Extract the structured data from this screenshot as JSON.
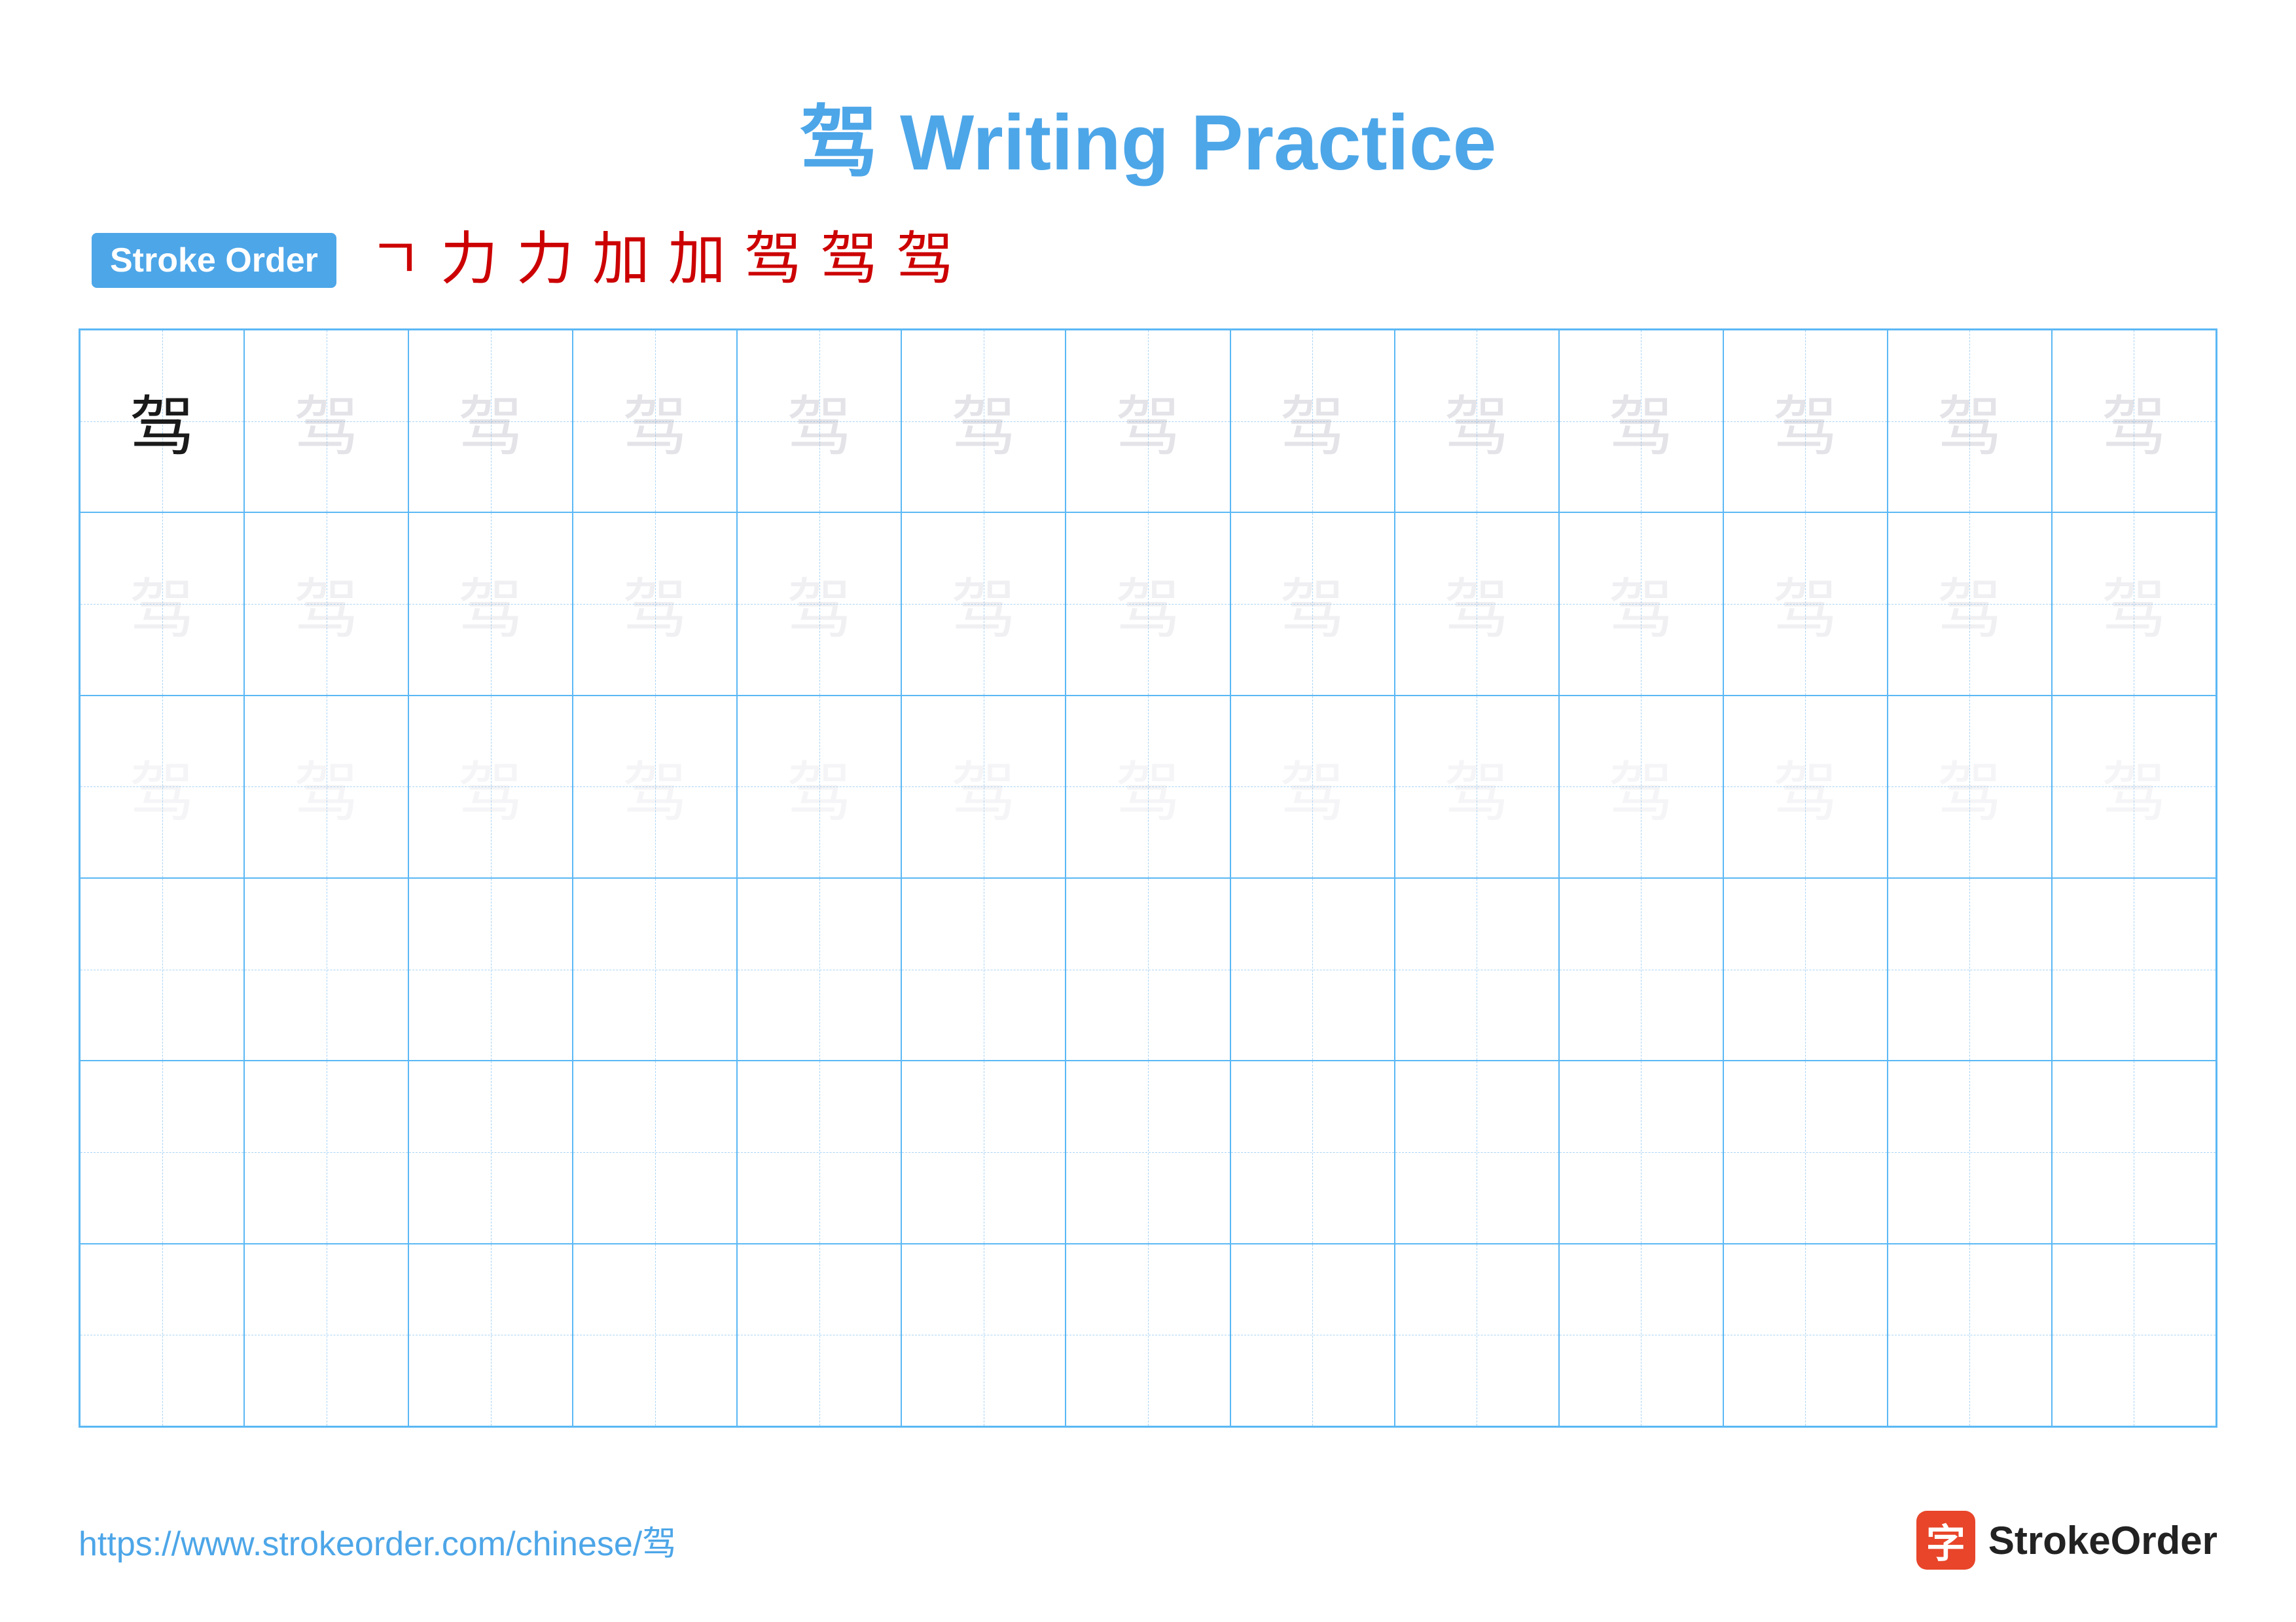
{
  "title": "驾 Writing Practice",
  "stroke_order": {
    "label": "Stroke Order",
    "chars": [
      "ㄱ",
      "力",
      "力",
      "加",
      "加",
      "驾",
      "驾",
      "驾"
    ]
  },
  "character": "驾",
  "grid": {
    "rows": 6,
    "cols": 13
  },
  "footer": {
    "url": "https://www.strokeorder.com/chinese/驾",
    "logo_char": "字",
    "logo_text": "StrokeOrder"
  }
}
